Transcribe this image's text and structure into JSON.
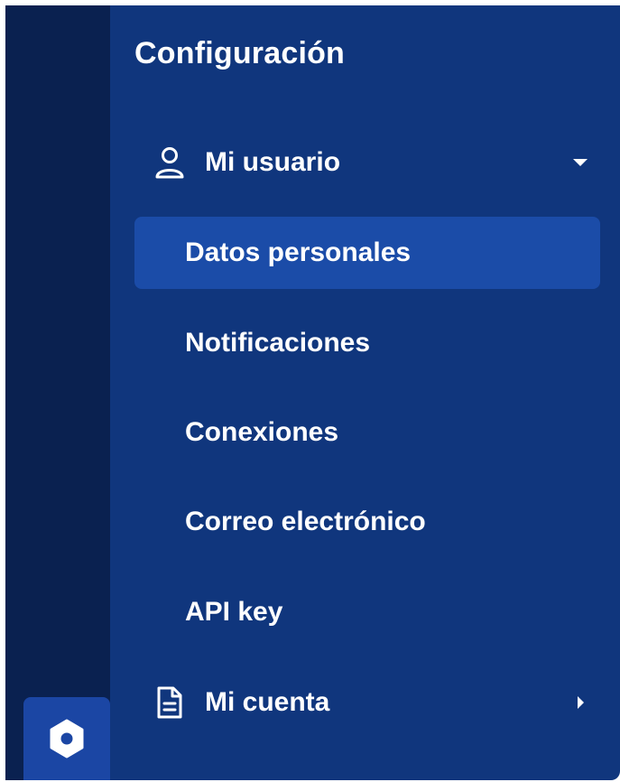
{
  "colors": {
    "rail_bg": "#0a2150",
    "panel_bg": "#10367d",
    "active_bg": "#1b4ca8",
    "rail_button_bg": "#1b46a4",
    "text": "#ffffff"
  },
  "panel": {
    "title": "Configuración"
  },
  "sections": {
    "user": {
      "label": "Mi usuario",
      "icon": "user-icon",
      "expanded": true,
      "items": [
        {
          "label": "Datos personales",
          "active": true
        },
        {
          "label": "Notificaciones",
          "active": false
        },
        {
          "label": "Conexiones",
          "active": false
        },
        {
          "label": "Correo electrónico",
          "active": false
        },
        {
          "label": "API key",
          "active": false
        }
      ]
    },
    "account": {
      "label": "Mi cuenta",
      "icon": "document-icon",
      "expanded": false
    }
  },
  "rail": {
    "settings_icon": "settings-hexagon-icon"
  }
}
